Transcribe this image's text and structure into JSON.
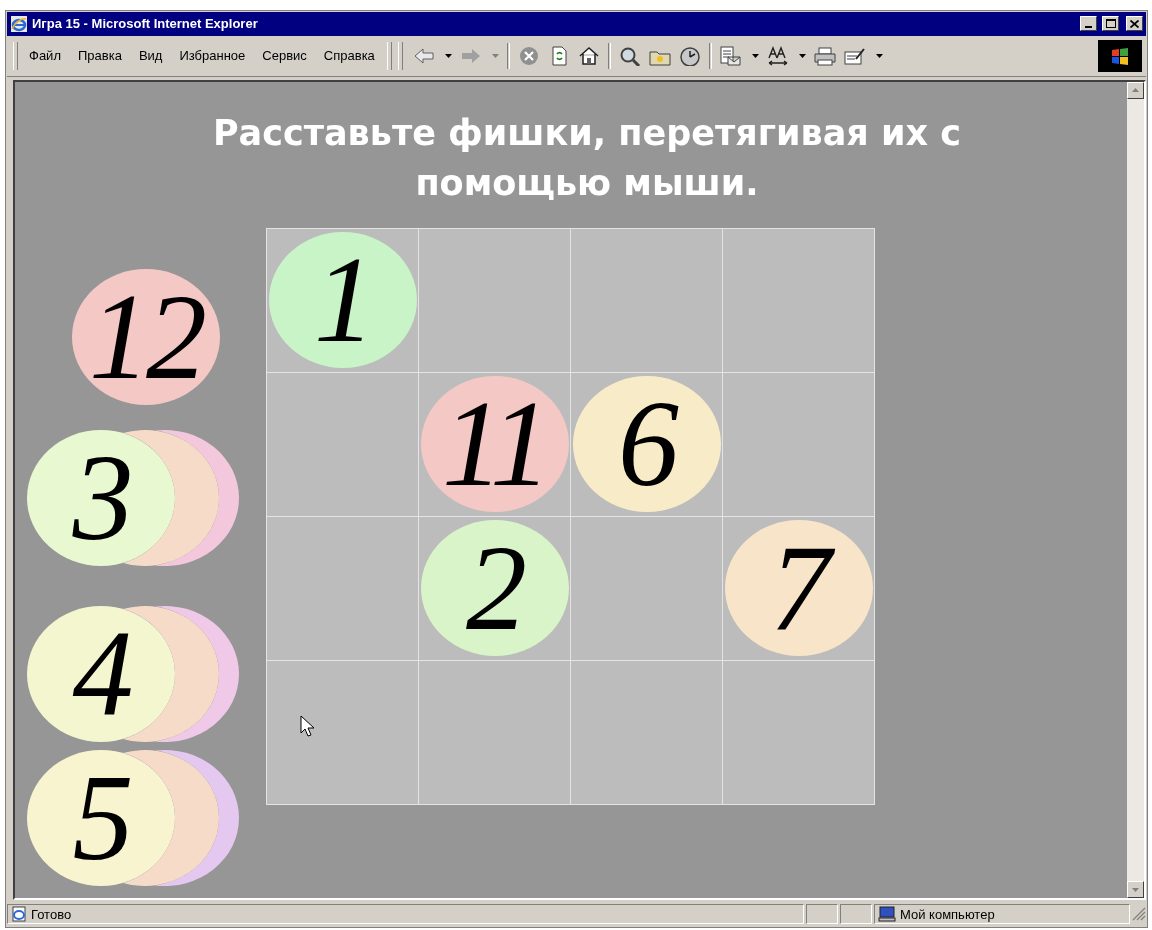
{
  "window": {
    "title": "Игра 15 - Microsoft Internet Explorer"
  },
  "menu": [
    "Файл",
    "Правка",
    "Вид",
    "Избранное",
    "Сервис",
    "Справка"
  ],
  "heading": "Расставьте фишки, перетягивая их с помощью мыши.",
  "board": {
    "rows": [
      [
        {
          "kind": "chip",
          "label": "1",
          "color": "#c8f4c8"
        },
        {
          "kind": "empty"
        },
        {
          "kind": "empty"
        },
        {
          "kind": "empty"
        }
      ],
      [
        {
          "kind": "empty"
        },
        {
          "kind": "chip",
          "label": "11",
          "color": "#f4c8c4"
        },
        {
          "kind": "chip",
          "label": "6",
          "color": "#f8ecc8"
        },
        {
          "kind": "empty"
        }
      ],
      [
        {
          "kind": "empty"
        },
        {
          "kind": "chip",
          "label": "2",
          "color": "#d8f4c8"
        },
        {
          "kind": "empty"
        },
        {
          "kind": "chip",
          "label": "7",
          "color": "#f8e4c8"
        }
      ],
      [
        {
          "kind": "empty"
        },
        {
          "kind": "empty"
        },
        {
          "kind": "empty"
        },
        {
          "kind": "empty"
        }
      ]
    ]
  },
  "tray": [
    {
      "chips": [
        {
          "label": "12",
          "color": "#f4c8c4"
        }
      ]
    },
    {
      "chips": [
        {
          "color": "#f4c8dc"
        },
        {
          "color": "#f6dcc8"
        },
        {
          "label": "3",
          "color": "#e8f8d0"
        }
      ]
    },
    {
      "chips": [
        {
          "color": "#f0c8e8"
        },
        {
          "color": "#f6dcc8"
        },
        {
          "label": "4",
          "color": "#f4f6d0"
        }
      ]
    },
    {
      "chips": [
        {
          "color": "#e4c8f0"
        },
        {
          "color": "#f6dcc8"
        },
        {
          "label": "5",
          "color": "#f8f4d0"
        }
      ]
    }
  ],
  "status_bar": {
    "text": "Готово",
    "zone": "Мой компьютер"
  }
}
